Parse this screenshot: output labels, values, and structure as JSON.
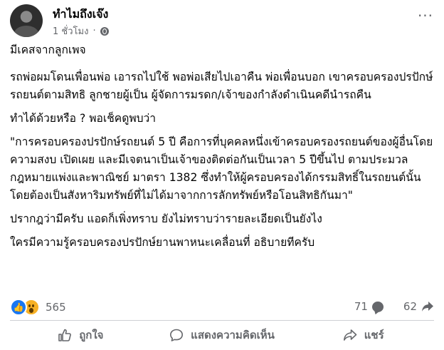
{
  "post": {
    "author": "ทำไมถึงเจ๊ง",
    "time": "1 ชั่วโมง",
    "paragraphs": [
      "มีเคสจากลูกเพจ",
      "รถพ่อผมโดนเพื่อนพ่อ เอารถไปใช้ พอพ่อเสียไปเอาคืน พ่อเพื่อนบอก เขาครอบครองปรปักษ์รถยนต์ตามสิทธิ ลูกชายผู้เป็น ผู้จัดการมรดก/เจ้าของกำลังดำเนินคดีนำรถคืน",
      "ทำได้ด้วยหรือ ? พอเช็คดูพบว่า",
      "\"การครอบครองปรปักษ์รถยนต์ 5 ปี คือการที่บุคคลหนึ่งเข้าครอบครองรถยนต์ของผู้อื่นโดยความสงบ เปิดเผย และมีเจตนาเป็นเจ้าของติดต่อกันเป็นเวลา 5 ปีขึ้นไป ตามประมวลกฎหมายแพ่งและพาณิชย์ มาตรา 1382 ซึ่งทำให้ผู้ครอบครองได้กรรมสิทธิ์ในรถยนต์นั้น โดยต้องเป็นสังหาริมทรัพย์ที่ไม่ได้มาจากการลักทรัพย์หรือโอนสิทธิกันมา\"",
      "ปรากฎว่ามีครับ แอดก็เพิ่งทราบ ยังไม่ทราบว่ารายละเอียดเป็นยังไง",
      "ใครมีความรู้ครอบครองปรปักษ์ยานพาหนะเคลื่อนที่ อธิบายทีครับ"
    ]
  },
  "stats": {
    "reactions": "565",
    "comments": "71",
    "shares": "62"
  },
  "actions": {
    "like": "ถูกใจ",
    "comment": "แสดงความคิดเห็น",
    "share": "แชร์"
  },
  "icons": {
    "visibility": "globe-icon",
    "more": "more-options-icon",
    "reaction_1": "like-reaction-icon",
    "reaction_2": "wow-reaction-icon"
  },
  "colors": {
    "secondary_text": "#65676b",
    "like_blue": "#1877f2",
    "wow_yellow": "#f7b125"
  }
}
